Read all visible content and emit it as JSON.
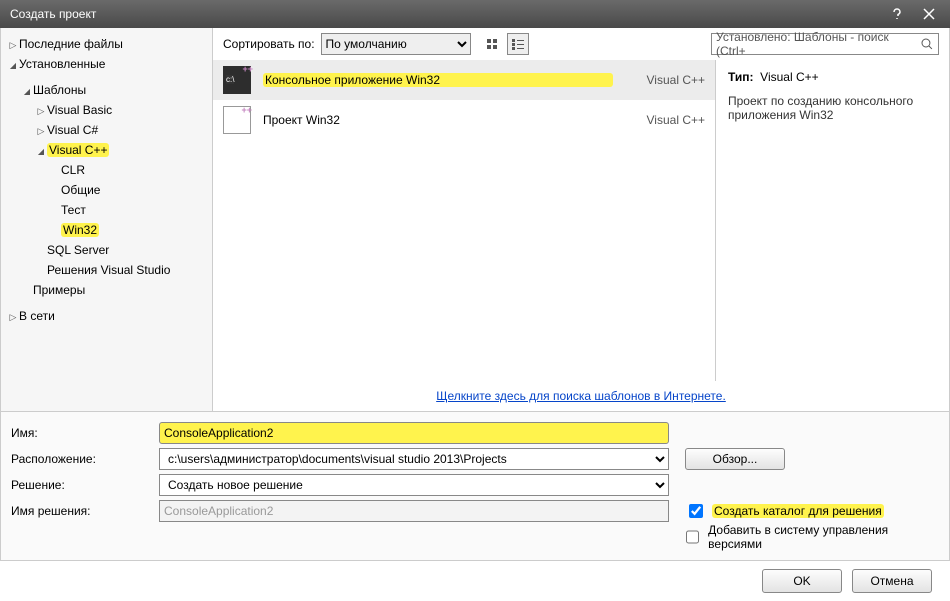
{
  "window": {
    "title": "Создать проект"
  },
  "sidebar": {
    "tabs": {
      "recent": "Последние файлы",
      "installed": "Установленные",
      "online": "В сети"
    },
    "templates_label": "Шаблоны",
    "langs": {
      "vb": "Visual Basic",
      "cs": "Visual C#",
      "cpp": "Visual C++"
    },
    "cpp_children": {
      "clr": "CLR",
      "general": "Общие",
      "test": "Тест",
      "win32": "Win32"
    },
    "extras": {
      "sql": "SQL Server",
      "vssolutions": "Решения Visual Studio",
      "samples": "Примеры"
    }
  },
  "toolbar": {
    "sort_label": "Сортировать по:",
    "sort_option": "По умолчанию",
    "search_placeholder": "Установлено: Шаблоны - поиск (Ctrl+"
  },
  "templates": {
    "console": {
      "name": "Консольное приложение Win32",
      "lang": "Visual C++"
    },
    "project": {
      "name": "Проект Win32",
      "lang": "Visual C++"
    }
  },
  "descpane": {
    "type_label": "Тип:",
    "type_value": "Visual C++",
    "description": "Проект по созданию консольного приложения Win32"
  },
  "online_link": "Щелкните здесь для поиска шаблонов в Интернете.",
  "form": {
    "name_label": "Имя:",
    "name_value": "ConsoleApplication2",
    "location_label": "Расположение:",
    "location_value": "c:\\users\\администратор\\documents\\visual studio 2013\\Projects",
    "solution_label": "Решение:",
    "solution_option": "Создать новое решение",
    "solution_name_label": "Имя решения:",
    "solution_name_value": "ConsoleApplication2",
    "browse": "Обзор...",
    "create_dir": "Создать каталог для решения",
    "add_source_control": "Добавить в систему управления версиями"
  },
  "actions": {
    "ok": "OK",
    "cancel": "Отмена"
  }
}
